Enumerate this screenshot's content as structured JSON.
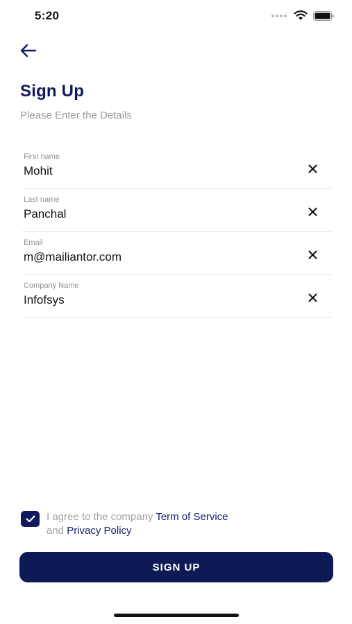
{
  "status_bar": {
    "time": "5:20",
    "icons": [
      "signal-dots-icon",
      "wifi-icon",
      "battery-icon"
    ]
  },
  "header": {
    "back_icon": "arrow-left-icon",
    "title": "Sign Up",
    "subtitle": "Please Enter the Details"
  },
  "form": {
    "fields": [
      {
        "label": "First name",
        "value": "Mohit",
        "clear_icon": "close-icon"
      },
      {
        "label": "Last name",
        "value": "Panchal",
        "clear_icon": "close-icon"
      },
      {
        "label": "Email",
        "value": "m@mailiantor.com",
        "clear_icon": "close-icon"
      },
      {
        "label": "Company Name",
        "value": "Infofsys",
        "clear_icon": "close-icon"
      }
    ]
  },
  "agreement": {
    "checked": true,
    "text_prefix": "I agree to the company ",
    "terms_link": "Term of Service",
    "text_middle": "and ",
    "privacy_link": "Privacy Policy"
  },
  "actions": {
    "signup_label": "SIGN UP"
  },
  "colors": {
    "primary": "#0d1a55",
    "title": "#0f1a5c",
    "muted": "#9a9a9a"
  }
}
